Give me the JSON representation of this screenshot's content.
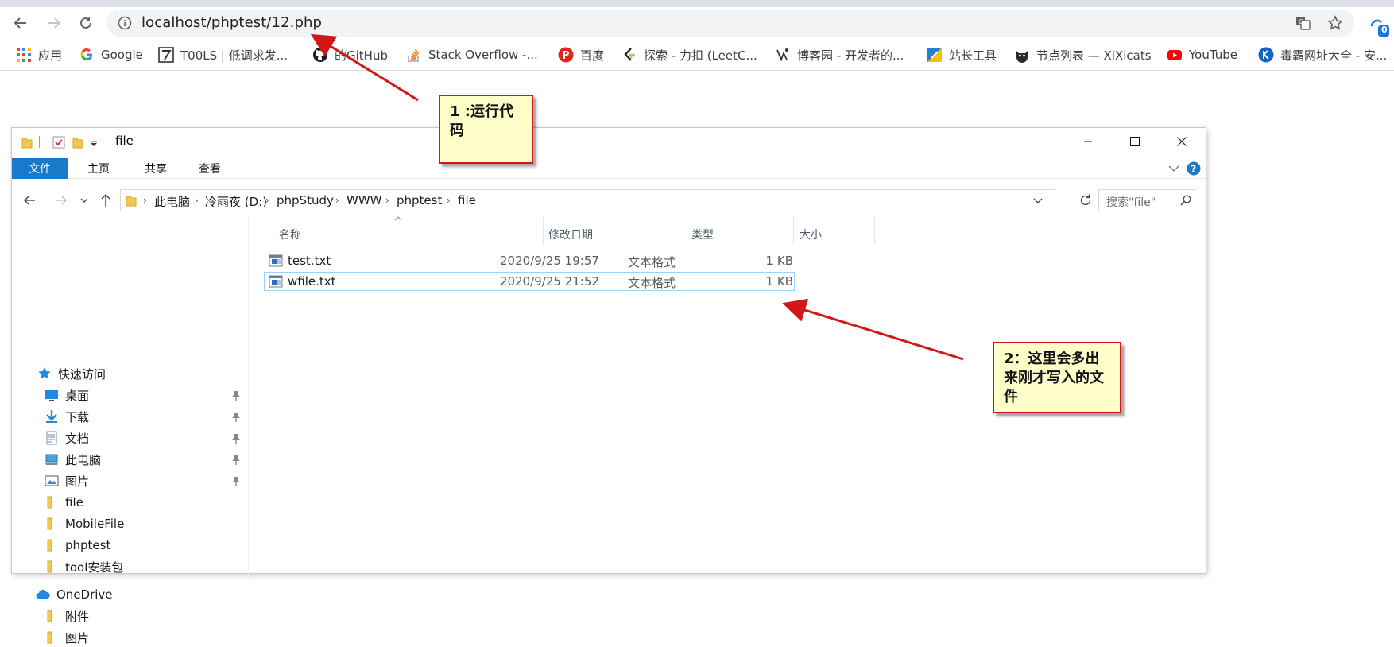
{
  "browser": {
    "url": "localhost/phptest/12.php",
    "extension_badge": "0",
    "bookmarks": [
      {
        "label": "应用",
        "icon": "apps-grid-icon"
      },
      {
        "label": "Google",
        "icon": "google-icon"
      },
      {
        "label": "T00LS | 低调求发...",
        "icon": "t00ls-icon"
      },
      {
        "label": "的GitHub",
        "icon": "github-icon"
      },
      {
        "label": "Stack Overflow -...",
        "icon": "stackoverflow-icon"
      },
      {
        "label": "百度",
        "icon": "baidu-icon"
      },
      {
        "label": "探索 - 力扣 (LeetC...",
        "icon": "leetcode-icon"
      },
      {
        "label": "博客园 - 开发者的...",
        "icon": "cnblogs-icon"
      },
      {
        "label": "站长工具",
        "icon": "chinaz-icon"
      },
      {
        "label": "节点列表 — XiXicats",
        "icon": "xixicats-icon"
      },
      {
        "label": "YouTube",
        "icon": "youtube-icon"
      },
      {
        "label": "毒霸网址大全 - 安...",
        "icon": "duba-icon"
      }
    ]
  },
  "explorer": {
    "title": "file",
    "ribbon_tabs": [
      "文件",
      "主页",
      "共享",
      "查看"
    ],
    "breadcrumbs": [
      "此电脑",
      "冷雨夜 (D:)",
      "phpStudy",
      "WWW",
      "phptest",
      "file"
    ],
    "search_placeholder": "搜索\"file\"",
    "nav": {
      "quick_access": "快速访问",
      "quick_items": [
        {
          "label": "桌面",
          "icon": "desktop-icon"
        },
        {
          "label": "下载",
          "icon": "download-icon"
        },
        {
          "label": "文档",
          "icon": "documents-icon"
        },
        {
          "label": "此电脑",
          "icon": "computer-icon"
        },
        {
          "label": "图片",
          "icon": "pictures-icon"
        }
      ],
      "folders": [
        "file",
        "MobileFile",
        "phptest",
        "tool安装包"
      ],
      "onedrive": "OneDrive",
      "onedrive_items": [
        "附件",
        "图片"
      ]
    },
    "columns": [
      "名称",
      "修改日期",
      "类型",
      "大小"
    ],
    "files": [
      {
        "name": "test.txt",
        "date": "2020/9/25 19:57",
        "type": "文本格式",
        "size": "1 KB",
        "selected": false
      },
      {
        "name": "wfile.txt",
        "date": "2020/9/25 21:52",
        "type": "文本格式",
        "size": "1 KB",
        "selected": true
      }
    ]
  },
  "annotations": {
    "note1": "1 :运行代码",
    "note2": "2：这里会多出来刚才写入的文件"
  },
  "colors": {
    "ribbon_file_tab": "#1979ca",
    "note_bg": "#ffffc9",
    "note_border": "#d2171b",
    "selection_border": "#99d1ff"
  }
}
